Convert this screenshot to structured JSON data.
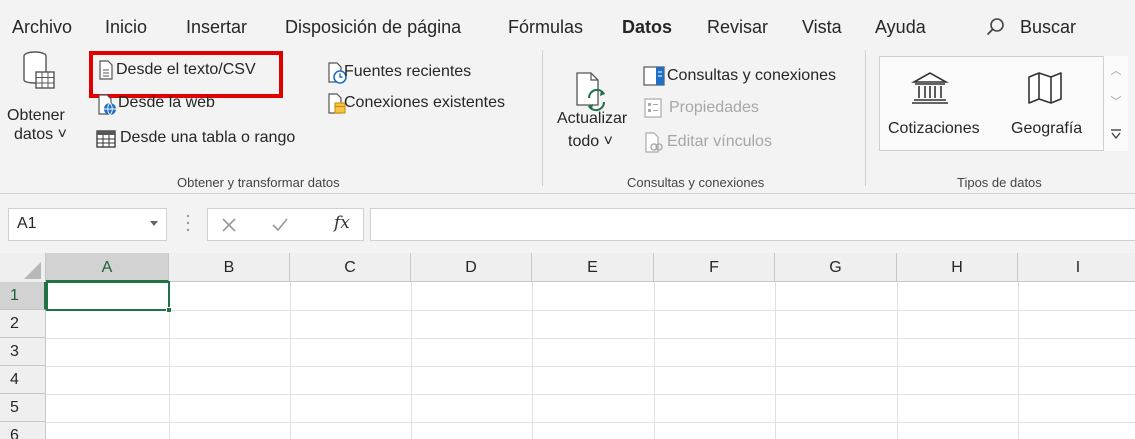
{
  "menu": {
    "tabs": [
      "Archivo",
      "Inicio",
      "Insertar",
      "Disposición de página",
      "Fórmulas",
      "Datos",
      "Revisar",
      "Vista",
      "Ayuda"
    ],
    "active_tab": "Datos",
    "search_label": "Buscar"
  },
  "ribbon": {
    "get_data": {
      "obtener_line1": "Obtener",
      "obtener_line2": "datos ˅",
      "desde_texto": "Desde el texto/CSV",
      "desde_web": "Desde la web",
      "desde_tabla": "Desde una tabla o rango",
      "fuentes_recientes": "Fuentes recientes",
      "conexiones_existentes": "Conexiones existentes",
      "group_label": "Obtener y transformar datos"
    },
    "queries": {
      "actualizar_line1": "Actualizar",
      "actualizar_line2": "todo ˅",
      "consultas": "Consultas y conexiones",
      "propiedades": "Propiedades",
      "editar_vinculos": "Editar vínculos",
      "group_label": "Consultas y conexiones"
    },
    "data_types": {
      "cotizaciones": "Cotizaciones",
      "geografia": "Geografía",
      "group_label": "Tipos de datos"
    }
  },
  "formula_bar": {
    "name_box": "A1",
    "fx_label": "fx",
    "formula": ""
  },
  "grid": {
    "columns": [
      "A",
      "B",
      "C",
      "D",
      "E",
      "F",
      "G",
      "H",
      "I"
    ],
    "rows": [
      "1",
      "2",
      "3",
      "4",
      "5",
      "6"
    ],
    "selected_cell": "A1"
  },
  "colors": {
    "accent": "#217346",
    "highlight": "#e00000",
    "ribbon_bg": "#f3f3f3"
  }
}
